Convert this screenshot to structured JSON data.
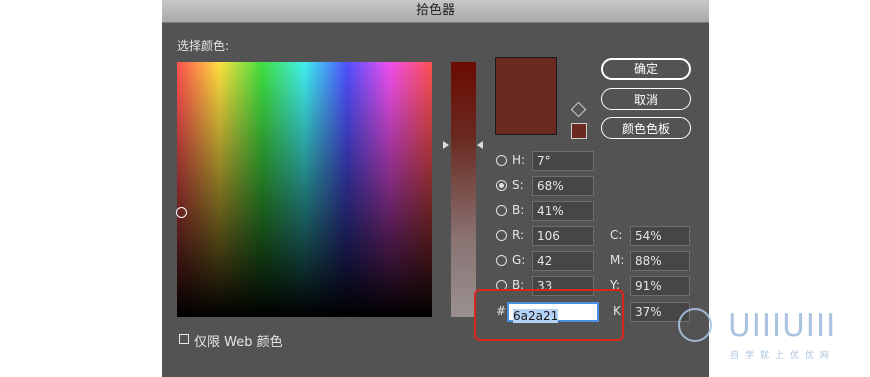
{
  "dialog": {
    "title": "拾色器",
    "select_color_label": "选择颜色:",
    "buttons": {
      "ok": "确定",
      "cancel": "取消",
      "swatches": "颜色色板"
    },
    "web_only_label": "仅限 Web 颜色",
    "hash_label": "#",
    "colors": {
      "new": "#6a2a21",
      "current": "#6a2a21"
    },
    "fields": {
      "H": {
        "label": "H:",
        "value": "7°"
      },
      "S": {
        "label": "S:",
        "value": "68%"
      },
      "Bri": {
        "label": "B:",
        "value": "41%"
      },
      "R": {
        "label": "R:",
        "value": "106"
      },
      "G": {
        "label": "G:",
        "value": "42"
      },
      "Bl": {
        "label": "B:",
        "value": "33"
      },
      "C": {
        "label": "C:",
        "value": "54%"
      },
      "M": {
        "label": "M:",
        "value": "88%"
      },
      "Y": {
        "label": "Y:",
        "value": "91%"
      },
      "K": {
        "label": "K",
        "value": "37%"
      },
      "hex": {
        "value": "6a2a21"
      }
    }
  },
  "watermark": {
    "brand": "UIIIUIII",
    "sub": "自学就上优优网"
  }
}
